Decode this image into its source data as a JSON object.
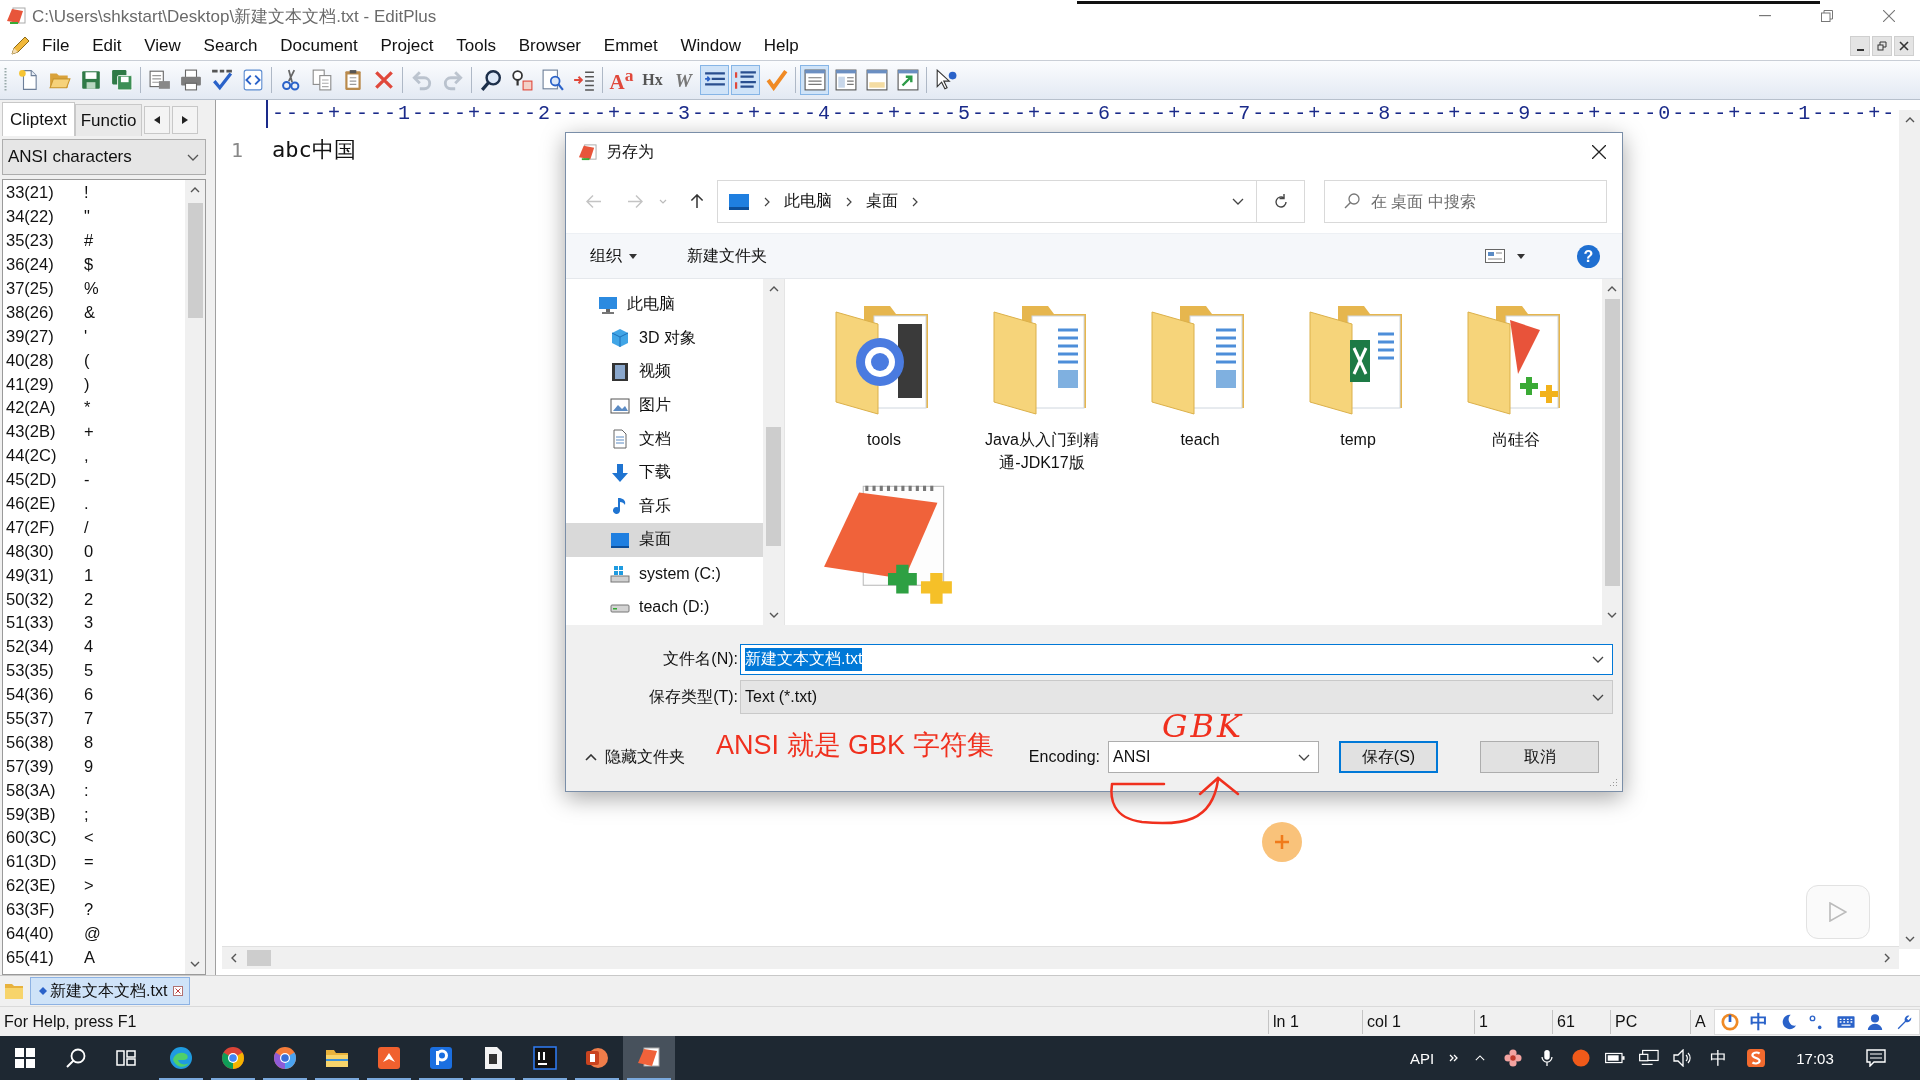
{
  "window": {
    "title": "C:\\Users\\shkstart\\Desktop\\新建文本文档.txt - EditPlus"
  },
  "menu": [
    "File",
    "Edit",
    "View",
    "Search",
    "Document",
    "Project",
    "Tools",
    "Browser",
    "Emmet",
    "Window",
    "Help"
  ],
  "toolbar": [
    {
      "kind": "command",
      "disabled": false
    },
    {
      "kind": "command",
      "disabled": false
    },
    {
      "kind": "command",
      "disabled": false
    },
    {
      "kind": "command",
      "disabled": false
    },
    {
      "kind": "separator"
    },
    {
      "kind": "command",
      "disabled": false
    },
    {
      "kind": "command",
      "disabled": false
    },
    {
      "kind": "command",
      "disabled": false
    },
    {
      "kind": "command",
      "disabled": false
    },
    {
      "kind": "separator"
    },
    {
      "kind": "command",
      "disabled": false
    },
    {
      "kind": "command",
      "disabled": false
    },
    {
      "kind": "command",
      "disabled": false
    },
    {
      "kind": "command",
      "disabled": false
    },
    {
      "kind": "separator"
    },
    {
      "kind": "command",
      "disabled": true
    },
    {
      "kind": "command",
      "disabled": true
    },
    {
      "kind": "separator"
    },
    {
      "kind": "command",
      "disabled": false
    },
    {
      "kind": "command",
      "disabled": false
    },
    {
      "kind": "command",
      "disabled": false
    },
    {
      "kind": "command",
      "disabled": false
    },
    {
      "kind": "separator"
    },
    {
      "kind": "command",
      "label": "A$^{a}$",
      "disabled": false
    },
    {
      "kind": "command",
      "label": "Hx",
      "disabled": false
    },
    {
      "kind": "command",
      "label": "W",
      "disabled": false
    },
    {
      "kind": "toggle",
      "on": true
    },
    {
      "kind": "toggle",
      "on": true
    },
    {
      "kind": "command",
      "disabled": false
    },
    {
      "kind": "separator"
    },
    {
      "kind": "toggle",
      "on": true
    },
    {
      "kind": "toggle",
      "on": false
    },
    {
      "kind": "toggle",
      "on": false
    },
    {
      "kind": "command",
      "disabled": false
    },
    {
      "kind": "separator"
    },
    {
      "kind": "command",
      "disabled": false
    }
  ],
  "side_panel": {
    "tabs": [
      {
        "label": "Cliptext",
        "selected": true
      },
      {
        "label": "Functio",
        "selected": false
      }
    ],
    "library": "ANSI characters",
    "entries": [
      {
        "code": "33(21)",
        "char": "!"
      },
      {
        "code": "34(22)",
        "char": "\""
      },
      {
        "code": "35(23)",
        "char": "#"
      },
      {
        "code": "36(24)",
        "char": "$"
      },
      {
        "code": "37(25)",
        "char": "%"
      },
      {
        "code": "38(26)",
        "char": "&"
      },
      {
        "code": "39(27)",
        "char": "'"
      },
      {
        "code": "40(28)",
        "char": "("
      },
      {
        "code": "41(29)",
        "char": ")"
      },
      {
        "code": "42(2A)",
        "char": "*"
      },
      {
        "code": "43(2B)",
        "char": "+"
      },
      {
        "code": "44(2C)",
        "char": ","
      },
      {
        "code": "45(2D)",
        "char": "-"
      },
      {
        "code": "46(2E)",
        "char": "."
      },
      {
        "code": "47(2F)",
        "char": "/"
      },
      {
        "code": "48(30)",
        "char": "0"
      },
      {
        "code": "49(31)",
        "char": "1"
      },
      {
        "code": "50(32)",
        "char": "2"
      },
      {
        "code": "51(33)",
        "char": "3"
      },
      {
        "code": "52(34)",
        "char": "4"
      },
      {
        "code": "53(35)",
        "char": "5"
      },
      {
        "code": "54(36)",
        "char": "6"
      },
      {
        "code": "55(37)",
        "char": "7"
      },
      {
        "code": "56(38)",
        "char": "8"
      },
      {
        "code": "57(39)",
        "char": "9"
      },
      {
        "code": "58(3A)",
        "char": ":"
      },
      {
        "code": "59(3B)",
        "char": ";"
      },
      {
        "code": "60(3C)",
        "char": "<"
      },
      {
        "code": "61(3D)",
        "char": "="
      },
      {
        "code": "62(3E)",
        "char": ">"
      },
      {
        "code": "63(3F)",
        "char": "?"
      },
      {
        "code": "64(40)",
        "char": "@"
      },
      {
        "code": "65(41)",
        "char": "A"
      }
    ]
  },
  "editor": {
    "ruler": "----+----1----+----2----+----3----+----4----+----5----+----6----+----7----+----8----+----9----+----0----+----1----+-",
    "lines": [
      {
        "number": "1",
        "text": "abc中国"
      }
    ]
  },
  "save_dialog": {
    "title": "另存为",
    "nav_buttons": [
      {
        "disabled": true
      },
      {
        "disabled": true
      },
      {
        "disabled": false
      }
    ],
    "breadcrumb": [
      "此电脑",
      "桌面"
    ],
    "search": {
      "placeholder": "在 桌面 中搜索"
    },
    "commands": {
      "organize": "组织",
      "new_folder": "新建文件夹",
      "help": "?"
    },
    "nav": [
      {
        "label": "此电脑",
        "selected": false,
        "children": [
          {
            "label": "3D 对象",
            "selected": false
          },
          {
            "label": "视频",
            "selected": false
          },
          {
            "label": "图片",
            "selected": false
          },
          {
            "label": "文档",
            "selected": false
          },
          {
            "label": "下载",
            "selected": false
          },
          {
            "label": "音乐",
            "selected": false
          },
          {
            "label": "桌面",
            "selected": true
          },
          {
            "label": "system (C:)",
            "selected": false
          },
          {
            "label": "teach (D:)",
            "selected": false
          }
        ]
      }
    ],
    "items": [
      {
        "kind": "folder",
        "label": "tools"
      },
      {
        "kind": "folder",
        "label": "Java从入门到精通-JDK17版"
      },
      {
        "kind": "folder",
        "label": "teach"
      },
      {
        "kind": "folder",
        "label": "temp"
      },
      {
        "kind": "folder",
        "label": "尚硅谷"
      },
      {
        "kind": "file"
      }
    ],
    "file_name": {
      "label": "文件名(N):",
      "value": "新建文本文档.txt",
      "selected": true
    },
    "save_type": {
      "label": "保存类型(T):",
      "value": "Text (*.txt)"
    },
    "hide_folders": "隐藏文件夹",
    "encoding": {
      "label": "Encoding:",
      "value": "ANSI"
    },
    "buttons": [
      {
        "label": "保存(S)",
        "default": true
      },
      {
        "label": "取消",
        "default": false
      }
    ]
  },
  "annotation": {
    "text": "ANSI 就是 GBK 字符集",
    "handwritten": "GBK"
  },
  "document_tabs": [
    {
      "label": "新建文本文档.txt",
      "selected": true
    }
  ],
  "status_bar": {
    "help": "For Help, press F1",
    "cells": [
      "ln 1",
      "col 1",
      "1",
      "61",
      "PC",
      "A"
    ],
    "ime": "中"
  },
  "taskbar": {
    "apps": [
      {
        "running": true,
        "selected": false
      },
      {
        "running": true,
        "selected": false
      },
      {
        "running": true,
        "selected": false
      },
      {
        "running": true,
        "selected": false
      },
      {
        "running": true,
        "selected": false
      },
      {
        "running": true,
        "selected": false
      },
      {
        "running": true,
        "selected": false
      },
      {
        "running": true,
        "selected": false
      },
      {
        "running": true,
        "selected": false
      },
      {
        "running": true,
        "selected": true
      }
    ],
    "tray_text": "API",
    "input_language": "中",
    "time": "17:03"
  }
}
